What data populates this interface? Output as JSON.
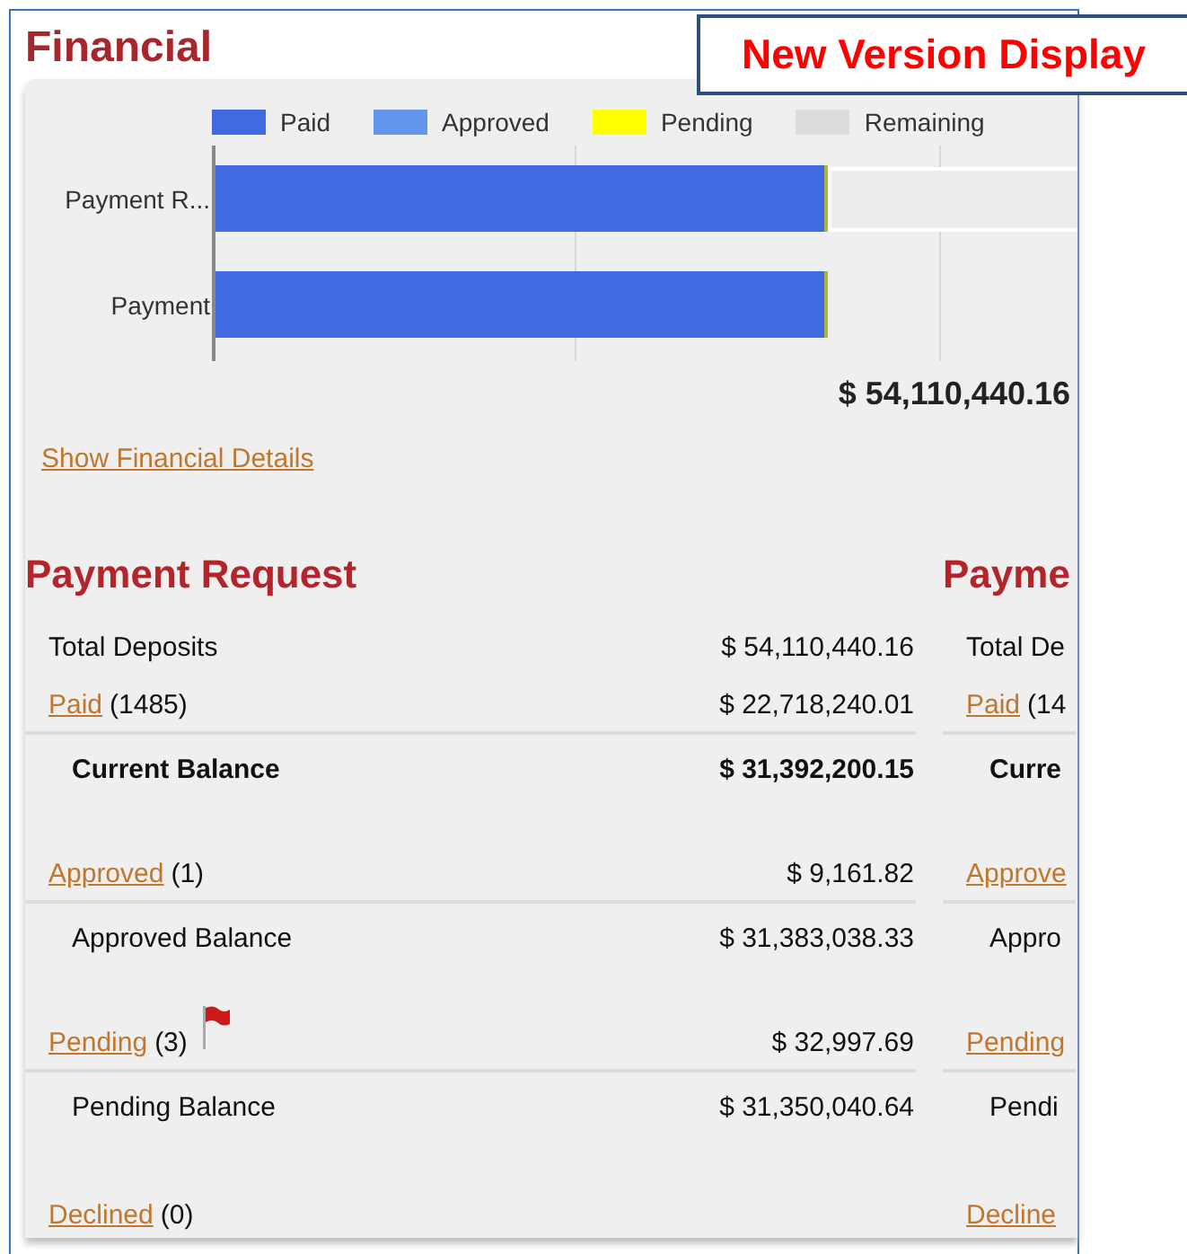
{
  "title": "Financial",
  "callout": "New Version Display",
  "chart": {
    "legend": [
      {
        "label": "Paid",
        "color": "#4169e1"
      },
      {
        "label": "Approved",
        "color": "#6495ed"
      },
      {
        "label": "Pending",
        "color": "#ffff00"
      },
      {
        "label": "Remaining",
        "color": "#dcdcdc"
      }
    ],
    "bars": [
      {
        "label": "Payment R...",
        "level": 0.71,
        "remaining": true
      },
      {
        "label": "Payment",
        "level": 0.71,
        "remaining": false
      }
    ],
    "total": "$ 54,110,440.16"
  },
  "details_link": "Show Financial Details",
  "sections": [
    {
      "title": "Payment Request",
      "rows": [
        {
          "kind": "plain",
          "label": "Total Deposits",
          "value": "$ 54,110,440.16"
        },
        {
          "kind": "link",
          "label": "Paid",
          "count": "(1485)",
          "value": "$ 22,718,240.01"
        },
        {
          "kind": "total",
          "label": "Current Balance",
          "value": "$ 31,392,200.15"
        },
        {
          "kind": "link",
          "label": "Approved",
          "count": "(1)",
          "value": "$ 9,161.82"
        },
        {
          "kind": "balance",
          "label": "Approved Balance",
          "value": "$ 31,383,038.33"
        },
        {
          "kind": "link",
          "label": "Pending",
          "count": "(3)",
          "flagged": true,
          "value": "$ 32,997.69"
        },
        {
          "kind": "balance",
          "label": "Pending Balance",
          "value": "$ 31,350,040.64"
        },
        {
          "kind": "link",
          "label": "Declined",
          "count": "(0)"
        }
      ]
    },
    {
      "title": "Payme",
      "rows": [
        {
          "kind": "plain",
          "label": "Total De"
        },
        {
          "kind": "link",
          "label": "Paid",
          "count": "(14"
        },
        {
          "kind": "total",
          "label": "Curre"
        },
        {
          "kind": "link",
          "label": "Approve"
        },
        {
          "kind": "balance",
          "label": "Appro"
        },
        {
          "kind": "link",
          "label": "Pending"
        },
        {
          "kind": "balance",
          "label": "Pendi"
        },
        {
          "kind": "link",
          "label": "Decline"
        }
      ]
    }
  ]
}
